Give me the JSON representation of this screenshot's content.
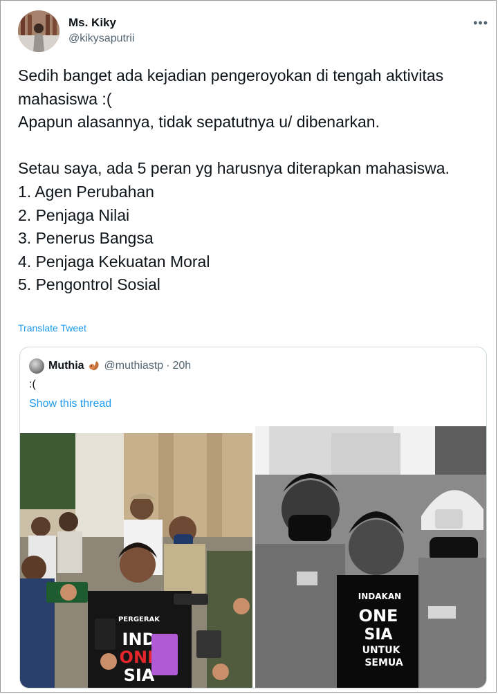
{
  "tweet": {
    "author_name": "Ms. Kiky",
    "author_handle": "@kikysaputrii",
    "more_icon": "more-horizontal-icon",
    "text": "Sedih banget ada kejadian pengeroyokan di tengah aktivitas mahasiswa :(\nApapun alasannya, tidak sepatutnya u/ dibenarkan.\n\nSetau saya, ada 5 peran yg harusnya diterapkan mahasiswa.\n1. Agen Perubahan\n2. Penjaga Nilai\n3. Penerus Bangsa\n4. Penjaga Kekuatan Moral\n5. Pengontrol Sosial",
    "translate_label": "Translate Tweet"
  },
  "quoted_tweet": {
    "author_name": "Muthia",
    "author_emoji": "squirrel-emoji",
    "author_handle": "@muthiastp",
    "separator": "·",
    "time": "20h",
    "text": ":(",
    "thread_link": "Show this thread",
    "images": [
      {
        "name": "crowd-photo",
        "shirt_text": [
          "PERGERAK",
          "IND",
          "ONE",
          "SIA"
        ]
      },
      {
        "name": "police-escort-photo",
        "shirt_text": [
          "INDAKAN",
          "ONE",
          "SIA",
          "UNTUK",
          "SEMUA"
        ]
      }
    ]
  },
  "colors": {
    "text": "#0f1419",
    "secondary": "#536471",
    "link": "#1d9bf0",
    "border": "#cfd9de"
  }
}
